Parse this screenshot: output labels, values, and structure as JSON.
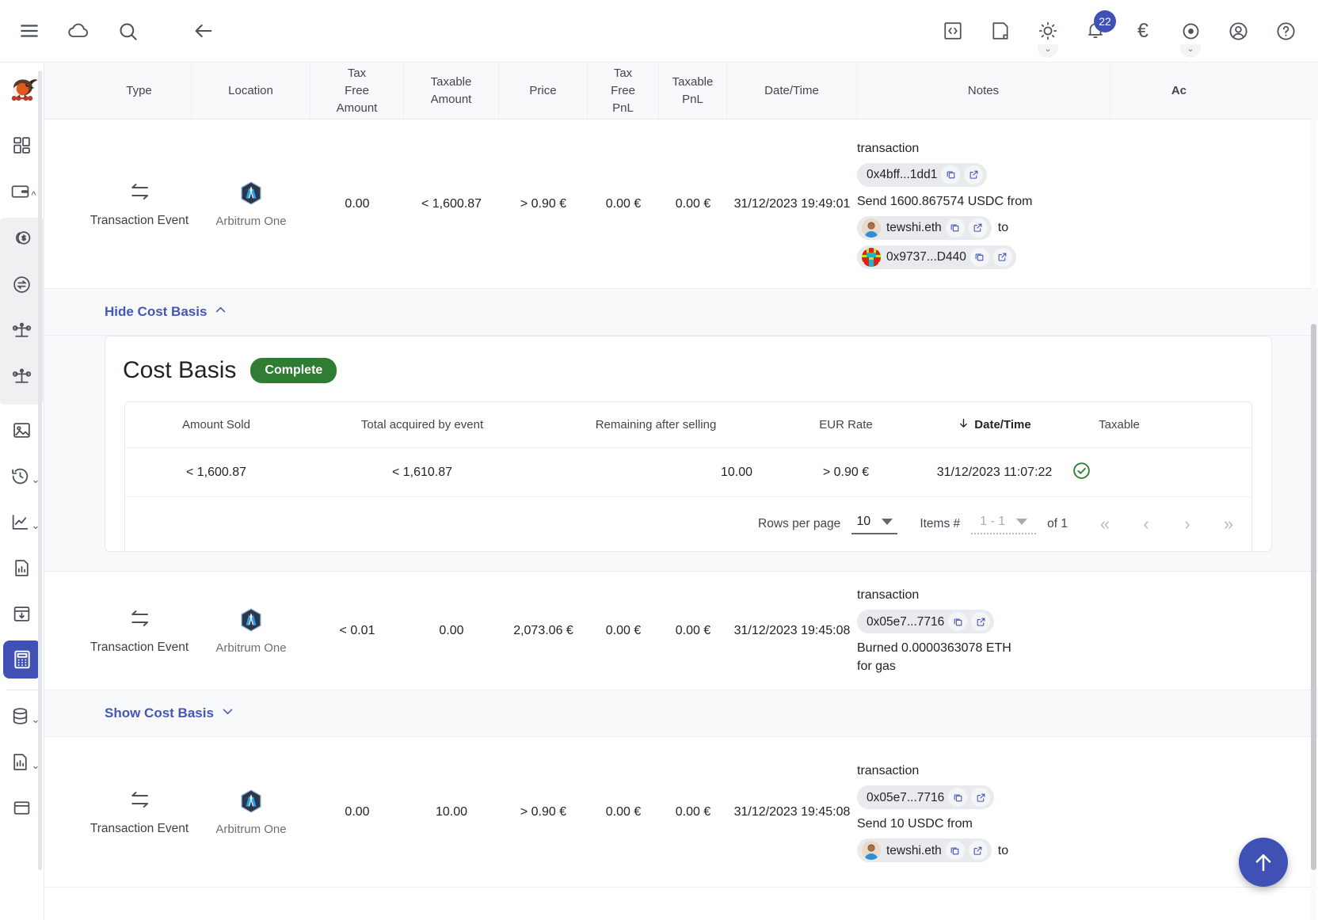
{
  "topbar": {
    "left_icons": [
      {
        "name": "menu-icon",
        "label": "Menu"
      },
      {
        "name": "cloud-icon",
        "label": "Cloud"
      },
      {
        "name": "search-icon",
        "label": "Search"
      },
      {
        "name": "back-arrow-icon",
        "label": "Back"
      }
    ],
    "right_icons": [
      {
        "name": "code-icon",
        "label": "Developer"
      },
      {
        "name": "note-icon",
        "label": "Notes"
      },
      {
        "name": "theme-sun-icon",
        "label": "Theme"
      },
      {
        "name": "notifications-bell-icon",
        "label": "Notifications"
      },
      {
        "name": "currency-euro-icon",
        "label": "€"
      },
      {
        "name": "privacy-eye-icon",
        "label": "Privacy mode"
      },
      {
        "name": "account-icon",
        "label": "Account"
      },
      {
        "name": "help-icon",
        "label": "Help"
      }
    ],
    "notification_count": "22",
    "currency_symbol": "€"
  },
  "sidebar": {
    "logo_name": "rotki-robin-logo",
    "items": [
      {
        "name": "dashboard-icon",
        "icon": "dashboard",
        "caret": false,
        "active": false
      },
      {
        "name": "wallet-icon",
        "icon": "wallet",
        "caret": "up",
        "active": false
      },
      {
        "name": "balances-coins-icon",
        "icon": "coins",
        "caret": false,
        "active": false,
        "grouped": true
      },
      {
        "name": "exchange-icon",
        "icon": "exchange",
        "caret": false,
        "active": false,
        "grouped": true
      },
      {
        "name": "balance-scale-icon",
        "icon": "scale",
        "caret": false,
        "active": false,
        "grouped": true
      },
      {
        "name": "liabilities-scale-icon",
        "icon": "scale",
        "caret": false,
        "active": false,
        "grouped": true
      },
      {
        "name": "nft-image-icon",
        "icon": "image",
        "caret": false,
        "active": false
      },
      {
        "name": "history-clock-icon",
        "icon": "history",
        "caret": "down",
        "active": false
      },
      {
        "name": "statistics-line-icon",
        "icon": "chart-line",
        "caret": "down",
        "active": false
      },
      {
        "name": "reports-document-icon",
        "icon": "chart-doc",
        "caret": false,
        "active": false
      },
      {
        "name": "import-box-icon",
        "icon": "import",
        "caret": false,
        "active": false
      },
      {
        "name": "tax-calculator-icon",
        "icon": "calculator",
        "caret": false,
        "active": true
      },
      {
        "name": "database-icon",
        "icon": "database",
        "caret": "down",
        "active": false
      },
      {
        "name": "analytics-report-icon",
        "icon": "chart-doc",
        "caret": "down",
        "active": false
      },
      {
        "name": "panel-icon",
        "icon": "panel",
        "caret": false,
        "active": false
      }
    ]
  },
  "table": {
    "headers": [
      {
        "key": "type",
        "lines": [
          "Type"
        ]
      },
      {
        "key": "location",
        "lines": [
          "Location"
        ]
      },
      {
        "key": "tax_free_amount",
        "lines": [
          "Tax",
          "Free",
          "Amount"
        ]
      },
      {
        "key": "taxable_amount",
        "lines": [
          "Taxable",
          "Amount"
        ]
      },
      {
        "key": "price",
        "lines": [
          "Price"
        ]
      },
      {
        "key": "tax_free_pnl",
        "lines": [
          "Tax",
          "Free",
          "PnL"
        ]
      },
      {
        "key": "taxable_pnl",
        "lines": [
          "Taxable",
          "PnL"
        ]
      },
      {
        "key": "datetime",
        "lines": [
          "Date/Time"
        ]
      },
      {
        "key": "notes",
        "lines": [
          "Notes"
        ]
      },
      {
        "key": "actions",
        "lines": [
          "Ac"
        ]
      }
    ],
    "rows": [
      {
        "type": "Transaction Event",
        "type_icon": "transfer-arrows-icon",
        "location": "Arbitrum One",
        "location_icon": "arbitrum-one-logo",
        "tax_free_amount": "0.00",
        "taxable_amount": "< 1,600.87",
        "price": "> 0.90 €",
        "tax_free_pnl": "0.00 €",
        "taxable_pnl": "0.00 €",
        "datetime": "31/12/2023 19:49:01",
        "notes": {
          "kind_label": "transaction",
          "tx_hash": "0x4bff...1dd1",
          "description_before": "Send 1600.867574 USDC from",
          "from_address": "tewshi.eth",
          "from_avatar": "person-avatar",
          "connector": "to",
          "to_address": "0x9737...D440",
          "to_avatar": "blockie-avatar"
        }
      },
      {
        "type": "Transaction Event",
        "type_icon": "transfer-arrows-icon",
        "location": "Arbitrum One",
        "location_icon": "arbitrum-one-logo",
        "tax_free_amount": "< 0.01",
        "taxable_amount": "0.00",
        "price": "2,073.06 €",
        "tax_free_pnl": "0.00 €",
        "taxable_pnl": "0.00 €",
        "datetime": "31/12/2023 19:45:08",
        "notes": {
          "kind_label": "transaction",
          "tx_hash": "0x05e7...7716",
          "description_before": "Burned 0.0000363078 ETH for gas"
        }
      },
      {
        "type": "Transaction Event",
        "type_icon": "transfer-arrows-icon",
        "location": "Arbitrum One",
        "location_icon": "arbitrum-one-logo",
        "tax_free_amount": "0.00",
        "taxable_amount": "10.00",
        "price": "> 0.90 €",
        "tax_free_pnl": "0.00 €",
        "taxable_pnl": "0.00 €",
        "datetime": "31/12/2023 19:45:08",
        "notes": {
          "kind_label": "transaction",
          "tx_hash": "0x05e7...7716",
          "description_before": "Send 10 USDC from",
          "from_address": "tewshi.eth",
          "from_avatar": "person-avatar",
          "connector": "to"
        }
      }
    ]
  },
  "cost_basis_expanded": {
    "toggle_label": "Hide Cost Basis",
    "toggle_chevron": "up",
    "title": "Cost Basis",
    "status_badge": "Complete",
    "headers": [
      {
        "key": "amount_sold",
        "label": "Amount Sold",
        "sorted": false
      },
      {
        "key": "total_acquired",
        "label": "Total acquired by event",
        "sorted": false
      },
      {
        "key": "remaining",
        "label": "Remaining after selling",
        "sorted": false
      },
      {
        "key": "eur_rate",
        "label": "EUR Rate",
        "sorted": false
      },
      {
        "key": "datetime",
        "label": "Date/Time",
        "sorted": true,
        "sort_direction": "down"
      },
      {
        "key": "taxable",
        "label": "Taxable",
        "sorted": false
      }
    ],
    "rows": [
      {
        "amount_sold": "< 1,600.87",
        "total_acquired": "< 1,610.87",
        "remaining": "10.00",
        "eur_rate": "> 0.90 €",
        "datetime": "31/12/2023 11:07:22",
        "taxable": true,
        "taxable_icon": "check-circle-icon"
      }
    ],
    "pagination": {
      "rows_per_page_label": "Rows per page",
      "rows_per_page_value": "10",
      "items_label": "Items #",
      "items_value": "1 - 1",
      "of_label": "of 1",
      "buttons": [
        {
          "name": "first-page-button",
          "glyph": "«"
        },
        {
          "name": "previous-page-button",
          "glyph": "‹"
        },
        {
          "name": "next-page-button",
          "glyph": "›"
        },
        {
          "name": "last-page-button",
          "glyph": "»"
        }
      ]
    }
  },
  "cost_basis_collapsed": {
    "toggle_label": "Show Cost Basis",
    "toggle_chevron": "down"
  },
  "fab": {
    "name": "scroll-to-top-button",
    "glyph": "↑"
  },
  "colors": {
    "accent": "#3f51b5",
    "link": "#4656b5",
    "success": "#2e7d32",
    "header_bg": "#f8f9fb",
    "chip_bg": "#e9eaee"
  }
}
